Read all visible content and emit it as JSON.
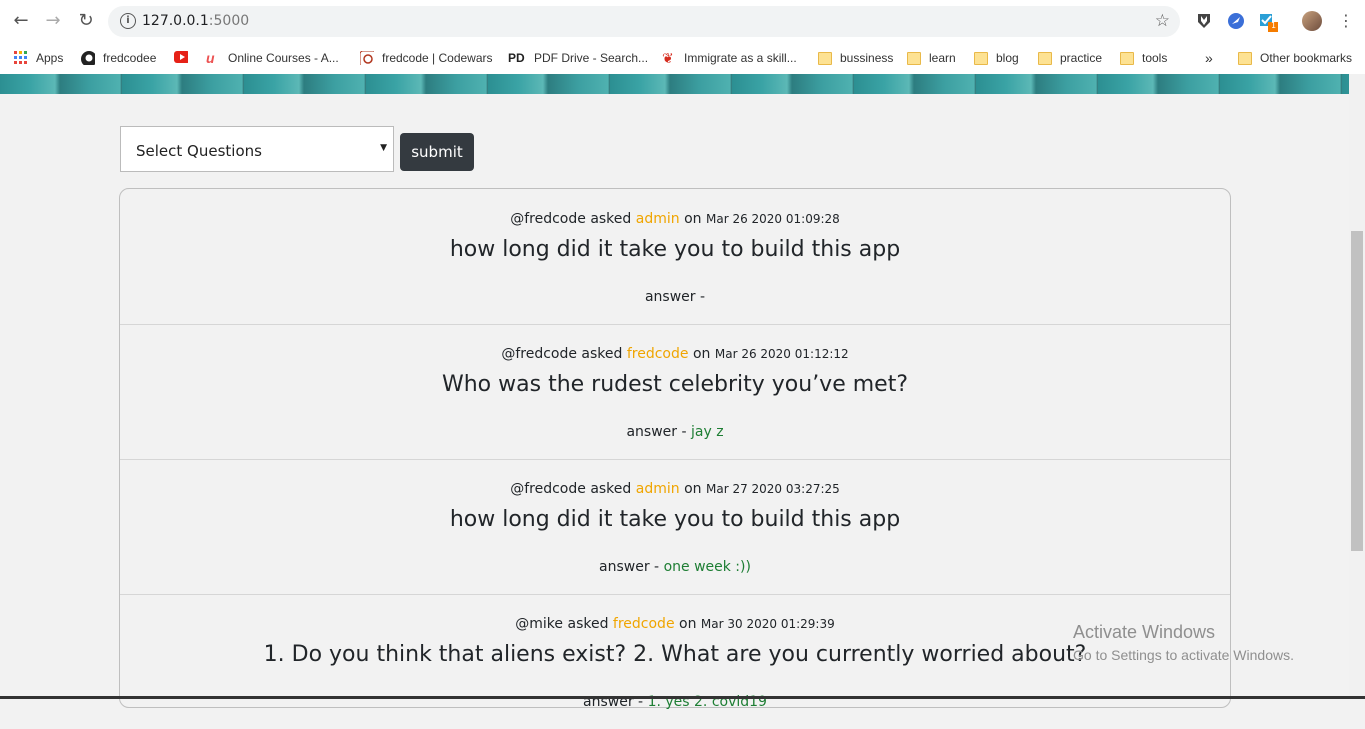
{
  "browser": {
    "url_host": "127.0.0.1",
    "url_port": ":5000",
    "bookmarks": [
      {
        "label": "Apps",
        "icon": "apps-grid-icon"
      },
      {
        "label": "fredcodee",
        "icon": "github-icon"
      },
      {
        "label": "",
        "icon": "youtube-icon"
      },
      {
        "label": "Online Courses - A...",
        "icon": "udemy-icon"
      },
      {
        "label": "fredcode | Codewars",
        "icon": "codewars-icon"
      },
      {
        "label": "PDF Drive - Search...",
        "icon": "pdfdrive-icon"
      },
      {
        "label": "Immigrate as a skill...",
        "icon": "maple-leaf-icon"
      },
      {
        "label": "bussiness",
        "icon": "folder-icon"
      },
      {
        "label": "learn",
        "icon": "folder-icon"
      },
      {
        "label": "blog",
        "icon": "folder-icon"
      },
      {
        "label": "practice",
        "icon": "folder-icon"
      },
      {
        "label": "tools",
        "icon": "folder-icon"
      }
    ],
    "overflow": "»",
    "other_bookmarks": "Other bookmarks",
    "ext_badge": "1"
  },
  "form": {
    "select_placeholder": "Select Questions",
    "submit_label": "submit"
  },
  "questions": [
    {
      "asker": "@fredcode",
      "verb": "asked",
      "target": "admin",
      "on": "on",
      "date": "Mar 26 2020 01:09:28",
      "text": "how long did it take you to build this app",
      "answer_label": "answer -",
      "answer": ""
    },
    {
      "asker": "@fredcode",
      "verb": "asked",
      "target": "fredcode",
      "on": "on",
      "date": "Mar 26 2020 01:12:12",
      "text": "Who was the rudest celebrity you’ve met?",
      "answer_label": "answer -",
      "answer": "jay z"
    },
    {
      "asker": "@fredcode",
      "verb": "asked",
      "target": "admin",
      "on": "on",
      "date": "Mar 27 2020 03:27:25",
      "text": "how long did it take you to build this app",
      "answer_label": "answer -",
      "answer": "one week :))"
    },
    {
      "asker": "@mike",
      "verb": "asked",
      "target": "fredcode",
      "on": "on",
      "date": "Mar 30 2020 01:29:39",
      "text": "1. Do you think that aliens exist? 2. What are you currently worried about?",
      "answer_label": "answer -",
      "answer": "1. yes 2. covid19"
    }
  ],
  "watermark": {
    "line1": "Activate Windows",
    "line2": "Go to Settings to activate Windows."
  },
  "colors": {
    "accent": "#f0a500",
    "answer": "#1e7e34",
    "button": "#343a40"
  }
}
